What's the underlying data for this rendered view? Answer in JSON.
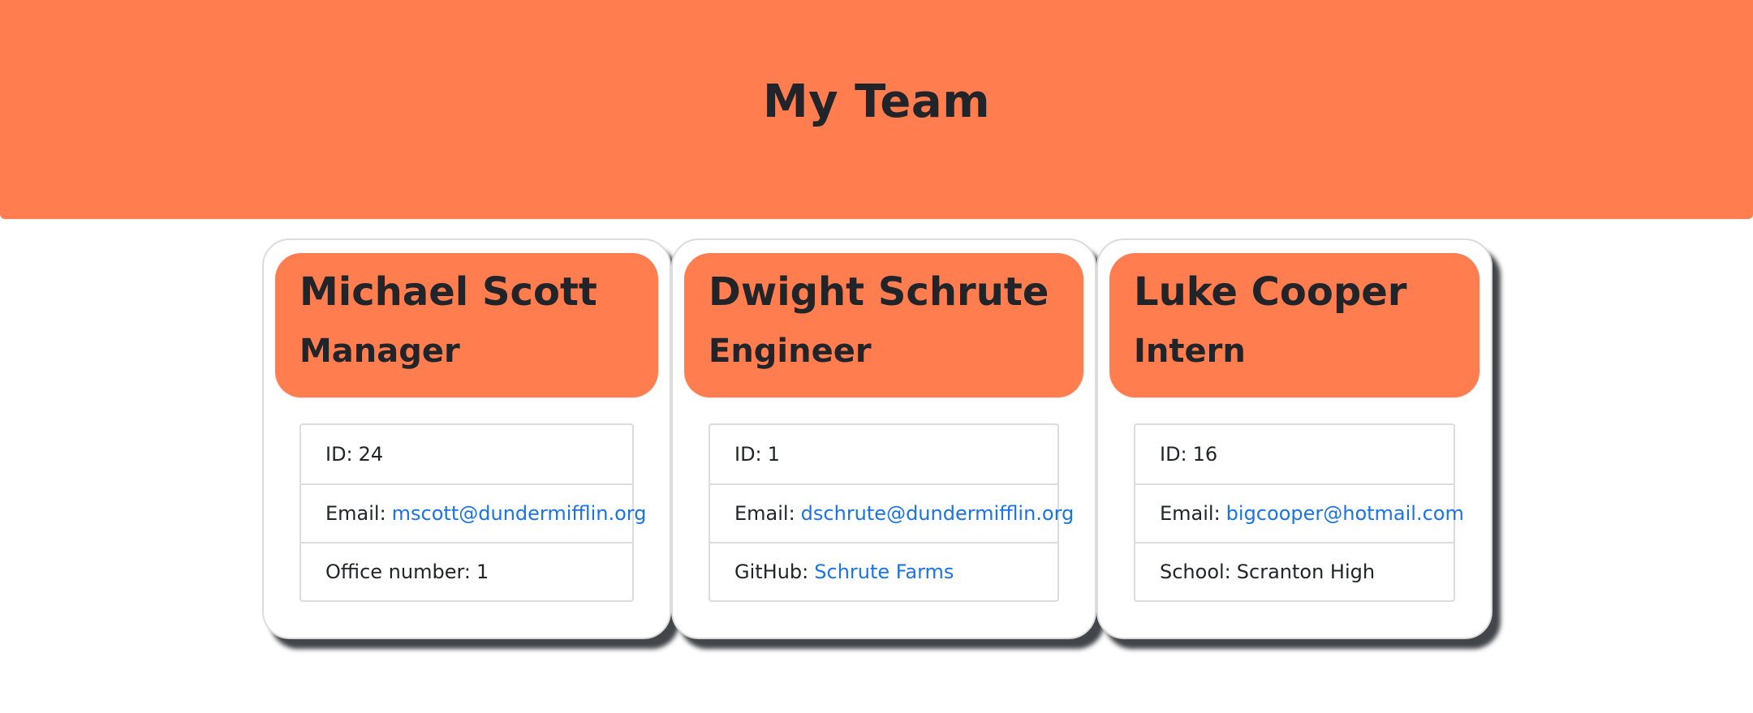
{
  "header": {
    "title": "My Team"
  },
  "employees": [
    {
      "name": "Michael Scott",
      "role": "Manager",
      "id_label": "ID:",
      "id": "24",
      "email_label": "Email:",
      "email": "mscott@dundermifflin.org",
      "extra_label": "Office number:",
      "extra_value": "1"
    },
    {
      "name": "Dwight Schrute",
      "role": "Engineer",
      "id_label": "ID:",
      "id": "1",
      "email_label": "Email:",
      "email": "dschrute@dundermifflin.org",
      "extra_label": "GitHub:",
      "extra_value": "Schrute Farms"
    },
    {
      "name": "Luke Cooper",
      "role": "Intern",
      "id_label": "ID:",
      "id": "16",
      "email_label": "Email:",
      "email": "bigcooper@hotmail.com",
      "extra_label": "School:",
      "extra_value": "Scranton High"
    }
  ],
  "colors": {
    "accent": "#ff7d4f",
    "link": "#1a73e8",
    "text": "#212529"
  }
}
